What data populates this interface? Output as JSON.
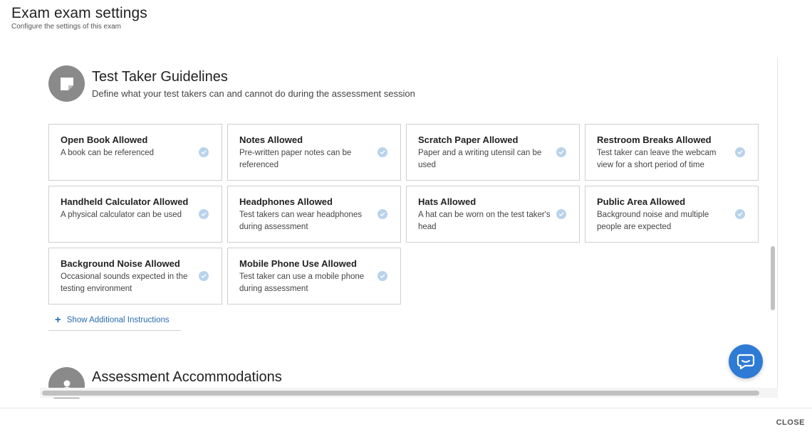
{
  "header": {
    "title": "Exam exam settings",
    "subtitle": "Configure the settings of this exam"
  },
  "guidelines": {
    "icon": "sticky-note-icon",
    "title": "Test Taker Guidelines",
    "description": "Define what your test takers can and cannot do during the assessment session",
    "cards": [
      {
        "title": "Open Book Allowed",
        "desc": "A book can be referenced"
      },
      {
        "title": "Notes Allowed",
        "desc": "Pre-written paper notes can be referenced"
      },
      {
        "title": "Scratch Paper Allowed",
        "desc": "Paper and a writing utensil can be used"
      },
      {
        "title": "Restroom Breaks Allowed",
        "desc": "Test taker can leave the webcam view for a short period of time"
      },
      {
        "title": "Handheld Calculator Allowed",
        "desc": "A physical calculator can be used"
      },
      {
        "title": "Headphones Allowed",
        "desc": "Test takers can wear headphones during assessment"
      },
      {
        "title": "Hats Allowed",
        "desc": "A hat can be worn on the test taker's head"
      },
      {
        "title": "Public Area Allowed",
        "desc": "Background noise and multiple people are expected"
      },
      {
        "title": "Background Noise Allowed",
        "desc": "Occasional sounds expected in the testing environment"
      },
      {
        "title": "Mobile Phone Use Allowed",
        "desc": "Test taker can use a mobile phone during assessment"
      }
    ],
    "show_more": {
      "icon": "plus-icon",
      "label": "Show Additional Instructions"
    }
  },
  "accommodations": {
    "icon": "user-icon",
    "title": "Assessment Accommodations"
  },
  "footer": {
    "close_label": "CLOSE"
  },
  "colors": {
    "accent": "#2b6cb0",
    "chat_button": "#2e7bd6",
    "section_icon_bg": "#8a8a8a",
    "check_bg": "#b9d3ec"
  }
}
